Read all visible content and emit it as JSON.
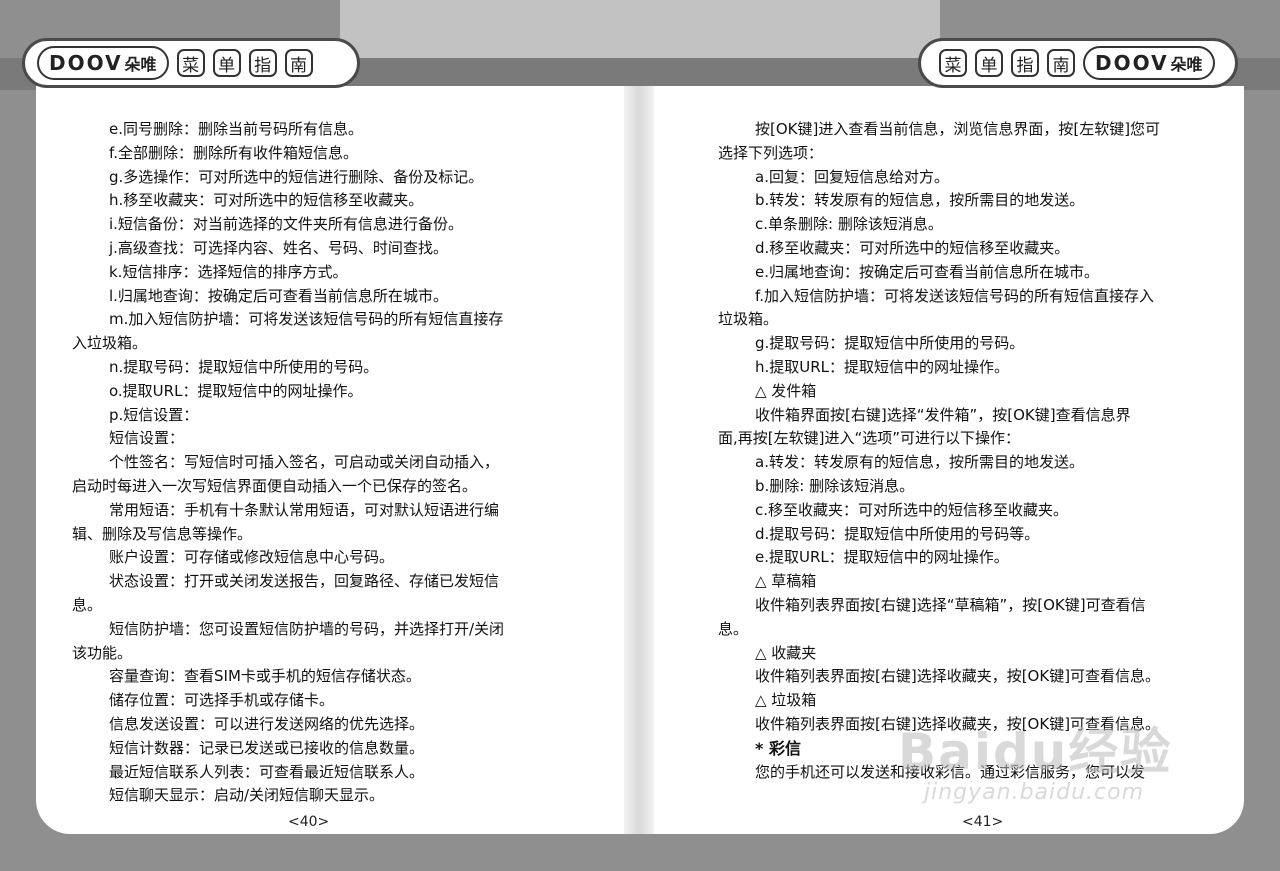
{
  "header_left": {
    "logo_text": "DOOV",
    "logo_cn": "朵唯",
    "menu_chars": [
      "菜",
      "单",
      "指",
      "南"
    ]
  },
  "header_right": {
    "logo_text": "DOOV",
    "logo_cn": "朵唯",
    "menu_chars": [
      "菜",
      "单",
      "指",
      "南"
    ]
  },
  "left_lines": [
    {
      "text": "e.同号删除：删除当前号码所有信息。",
      "indent": true
    },
    {
      "text": "f.全部删除：删除所有收件箱短信息。",
      "indent": true
    },
    {
      "text": "g.多选操作：可对所选中的短信进行删除、备份及标记。",
      "indent": true
    },
    {
      "text": "h.移至收藏夹：可对所选中的短信移至收藏夹。",
      "indent": true
    },
    {
      "text": "i.短信备份：对当前选择的文件夹所有信息进行备份。",
      "indent": true
    },
    {
      "text": "j.高级查找：可选择内容、姓名、号码、时间查找。",
      "indent": true
    },
    {
      "text": "k.短信排序：选择短信的排序方式。",
      "indent": true
    },
    {
      "text": "l.归属地查询：按确定后可查看当前信息所在城市。",
      "indent": true
    },
    {
      "text": "m.加入短信防护墙：可将发送该短信号码的所有短信直接存",
      "indent": true
    },
    {
      "text": "入垃圾箱。",
      "indent": false
    },
    {
      "text": "n.提取号码：提取短信中所使用的号码。",
      "indent": true
    },
    {
      "text": "o.提取URL：提取短信中的网址操作。",
      "indent": true
    },
    {
      "text": "p.短信设置：",
      "indent": true
    },
    {
      "text": "短信设置：",
      "indent": true
    },
    {
      "text": "个性签名：写短信时可插入签名，可启动或关闭自动插入，",
      "indent": true
    },
    {
      "text": "启动时每进入一次写短信界面便自动插入一个已保存的签名。",
      "indent": false
    },
    {
      "text": "常用短语：手机有十条默认常用短语，可对默认短语进行编",
      "indent": true
    },
    {
      "text": "辑、删除及写信息等操作。",
      "indent": false
    },
    {
      "text": "账户设置：可存储或修改短信息中心号码。",
      "indent": true
    },
    {
      "text": "状态设置：打开或关闭发送报告，回复路径、存储已发短信",
      "indent": true
    },
    {
      "text": "息。",
      "indent": false
    },
    {
      "text": "短信防护墙：您可设置短信防护墙的号码，并选择打开/关闭",
      "indent": true
    },
    {
      "text": "该功能。",
      "indent": false
    },
    {
      "text": "容量查询：查看SIM卡或手机的短信存储状态。",
      "indent": true
    },
    {
      "text": "储存位置：可选择手机或存储卡。",
      "indent": true
    },
    {
      "text": "信息发送设置：可以进行发送网络的优先选择。",
      "indent": true
    },
    {
      "text": "短信计数器：记录已发送或已接收的信息数量。",
      "indent": true
    },
    {
      "text": "最近短信联系人列表：可查看最近短信联系人。",
      "indent": true
    },
    {
      "text": "短信聊天显示：启动/关闭短信聊天显示。",
      "indent": true
    }
  ],
  "right_lines": [
    {
      "text": "按[OK键]进入查看当前信息，浏览信息界面，按[左软键]您可",
      "indent": true
    },
    {
      "text": "选择下列选项：",
      "indent": false
    },
    {
      "text": "a.回复：回复短信息给对方。",
      "indent": true
    },
    {
      "text": "b.转发：转发原有的短信息，按所需目的地发送。",
      "indent": true
    },
    {
      "text": "c.单条删除: 删除该短消息。",
      "indent": true
    },
    {
      "text": "d.移至收藏夹：可对所选中的短信移至收藏夹。",
      "indent": true
    },
    {
      "text": "e.归属地查询：按确定后可查看当前信息所在城市。",
      "indent": true
    },
    {
      "text": "f.加入短信防护墙：可将发送该短信号码的所有短信直接存入",
      "indent": true
    },
    {
      "text": "垃圾箱。",
      "indent": false
    },
    {
      "text": "g.提取号码：提取短信中所使用的号码。",
      "indent": true
    },
    {
      "text": "h.提取URL：提取短信中的网址操作。",
      "indent": true
    },
    {
      "text": "△ 发件箱",
      "indent": true
    },
    {
      "text": "收件箱界面按[右键]选择“发件箱”，按[OK键]查看信息界",
      "indent": true
    },
    {
      "text": "面,再按[左软键]进入“选项”可进行以下操作：",
      "indent": false
    },
    {
      "text": "a.转发：转发原有的短信息，按所需目的地发送。",
      "indent": true
    },
    {
      "text": "b.删除: 删除该短消息。",
      "indent": true
    },
    {
      "text": "c.移至收藏夹：可对所选中的短信移至收藏夹。",
      "indent": true
    },
    {
      "text": "d.提取号码：提取短信中所使用的号码等。",
      "indent": true
    },
    {
      "text": "e.提取URL：提取短信中的网址操作。",
      "indent": true
    },
    {
      "text": "△ 草稿箱",
      "indent": true
    },
    {
      "text": "收件箱列表界面按[右键]选择“草稿箱”，按[OK键]可查看信",
      "indent": true
    },
    {
      "text": "息。",
      "indent": false
    },
    {
      "text": "△ 收藏夹",
      "indent": true
    },
    {
      "text": "收件箱列表界面按[右键]选择收藏夹，按[OK键]可查看信息。",
      "indent": true
    },
    {
      "text": "△ 垃圾箱",
      "indent": true
    },
    {
      "text": "收件箱列表界面按[右键]选择收藏夹，按[OK键]可查看信息。",
      "indent": true
    },
    {
      "text": "* 彩信",
      "indent": true,
      "bold": true
    },
    {
      "text": "您的手机还可以发送和接收彩信。通过彩信服务，您可以发",
      "indent": true
    }
  ],
  "page_numbers": {
    "left": "<40>",
    "right": "<41>"
  },
  "watermark": {
    "main": "Baidu经验",
    "sub": "jingyan.baidu.com"
  }
}
